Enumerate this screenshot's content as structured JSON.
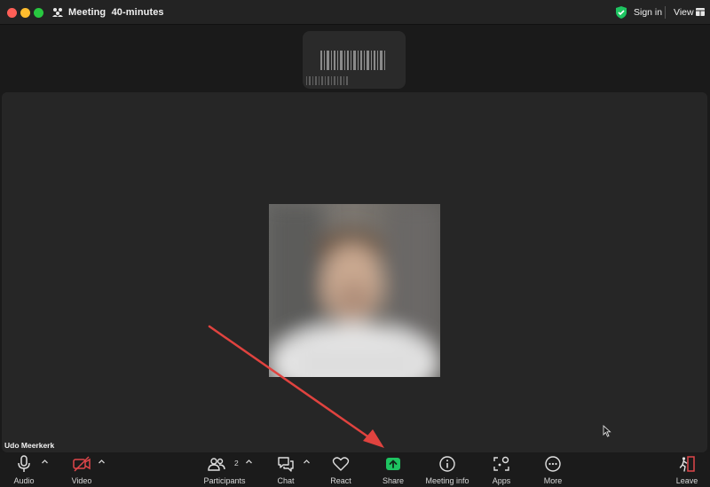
{
  "window": {
    "title": "Meeting",
    "duration": "40-minutes",
    "sign_in_label": "Sign in",
    "view_label": "View"
  },
  "participant": {
    "name": "Udo Meerkerk"
  },
  "toolbar": {
    "audio_label": "Audio",
    "video_label": "Video",
    "participants_label": "Participants",
    "participants_count": "2",
    "chat_label": "Chat",
    "react_label": "React",
    "share_label": "Share",
    "meeting_info_label": "Meeting info",
    "apps_label": "Apps",
    "more_label": "More",
    "leave_label": "Leave"
  },
  "colors": {
    "share_accent": "#1ec461",
    "video_off": "#e0464a",
    "leave_accent": "#e0464a",
    "shield": "#1ec461",
    "annotation_arrow": "#e0433f"
  },
  "icons": {
    "audio": "microphone-icon",
    "video": "video-off-icon",
    "participants": "participants-icon",
    "chat": "chat-bubbles-icon",
    "react": "heart-icon",
    "share": "share-screen-icon",
    "meeting_info": "info-icon",
    "apps": "apps-icon",
    "more": "more-dots-icon",
    "leave": "leave-door-icon"
  }
}
